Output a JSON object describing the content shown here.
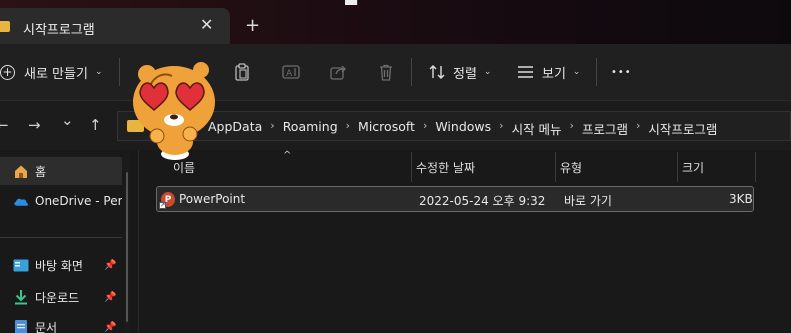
{
  "window": {
    "tab_title": "시작프로그램",
    "tab_close": "✕",
    "new_tab": "+"
  },
  "toolbar": {
    "new_label": "새로 만들기",
    "sort_label": "정렬",
    "view_label": "보기",
    "more_label": "•••",
    "icons": [
      "cut-icon",
      "copy-icon",
      "paste-icon",
      "rename-icon",
      "share-icon",
      "delete-icon",
      "sort-icon",
      "view-icon"
    ]
  },
  "nav": {
    "back": "←",
    "forward": "→",
    "recent": "⌄",
    "up": "↑",
    "breadcrumbs": [
      "AppData",
      "Roaming",
      "Microsoft",
      "Windows",
      "시작 메뉴",
      "프로그램",
      "시작프로그램"
    ],
    "separator": "›"
  },
  "sidebar": {
    "items": [
      {
        "label": "홈",
        "icon": "home-icon",
        "pinned": false
      },
      {
        "label": "OneDrive - Pers",
        "icon": "onedrive-icon",
        "pinned": false
      },
      {
        "label": "바탕 화면",
        "icon": "desktop-icon",
        "pinned": true
      },
      {
        "label": "다운로드",
        "icon": "download-icon",
        "pinned": true
      },
      {
        "label": "문서",
        "icon": "documents-icon",
        "pinned": true
      }
    ]
  },
  "columns": {
    "name": "이름",
    "modified": "수정한 날짜",
    "type": "유형",
    "size": "크기",
    "sort_indicator": "^"
  },
  "files": [
    {
      "name": "PowerPoint",
      "modified": "2022-05-24 오후 9:32",
      "type": "바로 가기",
      "size": "3KB",
      "icon": "powerpoint-shortcut-icon"
    }
  ],
  "colors": {
    "folder": "#e8b640",
    "accent_red": "#e0303a",
    "sticker_fur": "#f0a23a"
  }
}
